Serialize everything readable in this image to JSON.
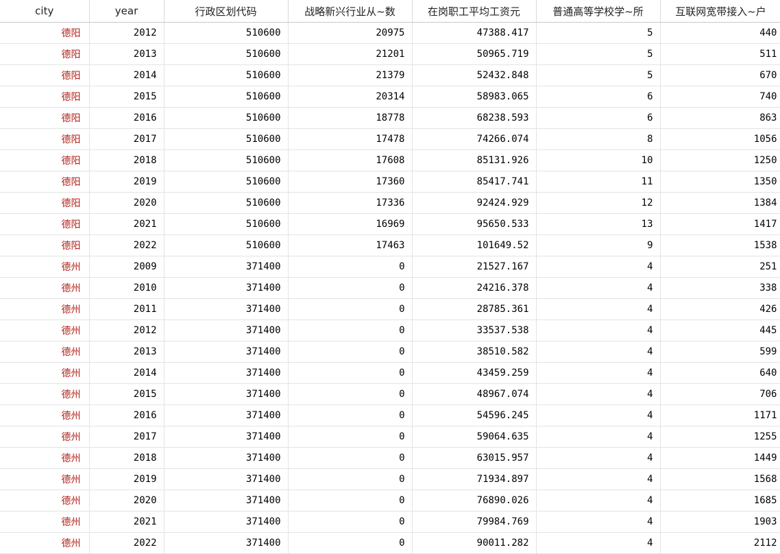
{
  "columns": [
    "city",
    "year",
    "行政区划代码",
    "战略新兴行业从~数",
    "在岗职工平均工资元",
    "普通高等学校学~所",
    "互联网宽带接入~户"
  ],
  "colors": {
    "city_text": "#b3201a",
    "grid_line": "#e3e3e3"
  },
  "rows": [
    [
      "德阳",
      "2012",
      "510600",
      "20975",
      "47388.417",
      "5",
      "440"
    ],
    [
      "德阳",
      "2013",
      "510600",
      "21201",
      "50965.719",
      "5",
      "511"
    ],
    [
      "德阳",
      "2014",
      "510600",
      "21379",
      "52432.848",
      "5",
      "670"
    ],
    [
      "德阳",
      "2015",
      "510600",
      "20314",
      "58983.065",
      "6",
      "740"
    ],
    [
      "德阳",
      "2016",
      "510600",
      "18778",
      "68238.593",
      "6",
      "863"
    ],
    [
      "德阳",
      "2017",
      "510600",
      "17478",
      "74266.074",
      "8",
      "1056"
    ],
    [
      "德阳",
      "2018",
      "510600",
      "17608",
      "85131.926",
      "10",
      "1250"
    ],
    [
      "德阳",
      "2019",
      "510600",
      "17360",
      "85417.741",
      "11",
      "1350"
    ],
    [
      "德阳",
      "2020",
      "510600",
      "17336",
      "92424.929",
      "12",
      "1384"
    ],
    [
      "德阳",
      "2021",
      "510600",
      "16969",
      "95650.533",
      "13",
      "1417"
    ],
    [
      "德阳",
      "2022",
      "510600",
      "17463",
      "101649.52",
      "9",
      "1538"
    ],
    [
      "德州",
      "2009",
      "371400",
      "0",
      "21527.167",
      "4",
      "251"
    ],
    [
      "德州",
      "2010",
      "371400",
      "0",
      "24216.378",
      "4",
      "338"
    ],
    [
      "德州",
      "2011",
      "371400",
      "0",
      "28785.361",
      "4",
      "426"
    ],
    [
      "德州",
      "2012",
      "371400",
      "0",
      "33537.538",
      "4",
      "445"
    ],
    [
      "德州",
      "2013",
      "371400",
      "0",
      "38510.582",
      "4",
      "599"
    ],
    [
      "德州",
      "2014",
      "371400",
      "0",
      "43459.259",
      "4",
      "640"
    ],
    [
      "德州",
      "2015",
      "371400",
      "0",
      "48967.074",
      "4",
      "706"
    ],
    [
      "德州",
      "2016",
      "371400",
      "0",
      "54596.245",
      "4",
      "1171"
    ],
    [
      "德州",
      "2017",
      "371400",
      "0",
      "59064.635",
      "4",
      "1255"
    ],
    [
      "德州",
      "2018",
      "371400",
      "0",
      "63015.957",
      "4",
      "1449"
    ],
    [
      "德州",
      "2019",
      "371400",
      "0",
      "71934.897",
      "4",
      "1568"
    ],
    [
      "德州",
      "2020",
      "371400",
      "0",
      "76890.026",
      "4",
      "1685"
    ],
    [
      "德州",
      "2021",
      "371400",
      "0",
      "79984.769",
      "4",
      "1903"
    ],
    [
      "德州",
      "2022",
      "371400",
      "0",
      "90011.282",
      "4",
      "2112"
    ]
  ]
}
